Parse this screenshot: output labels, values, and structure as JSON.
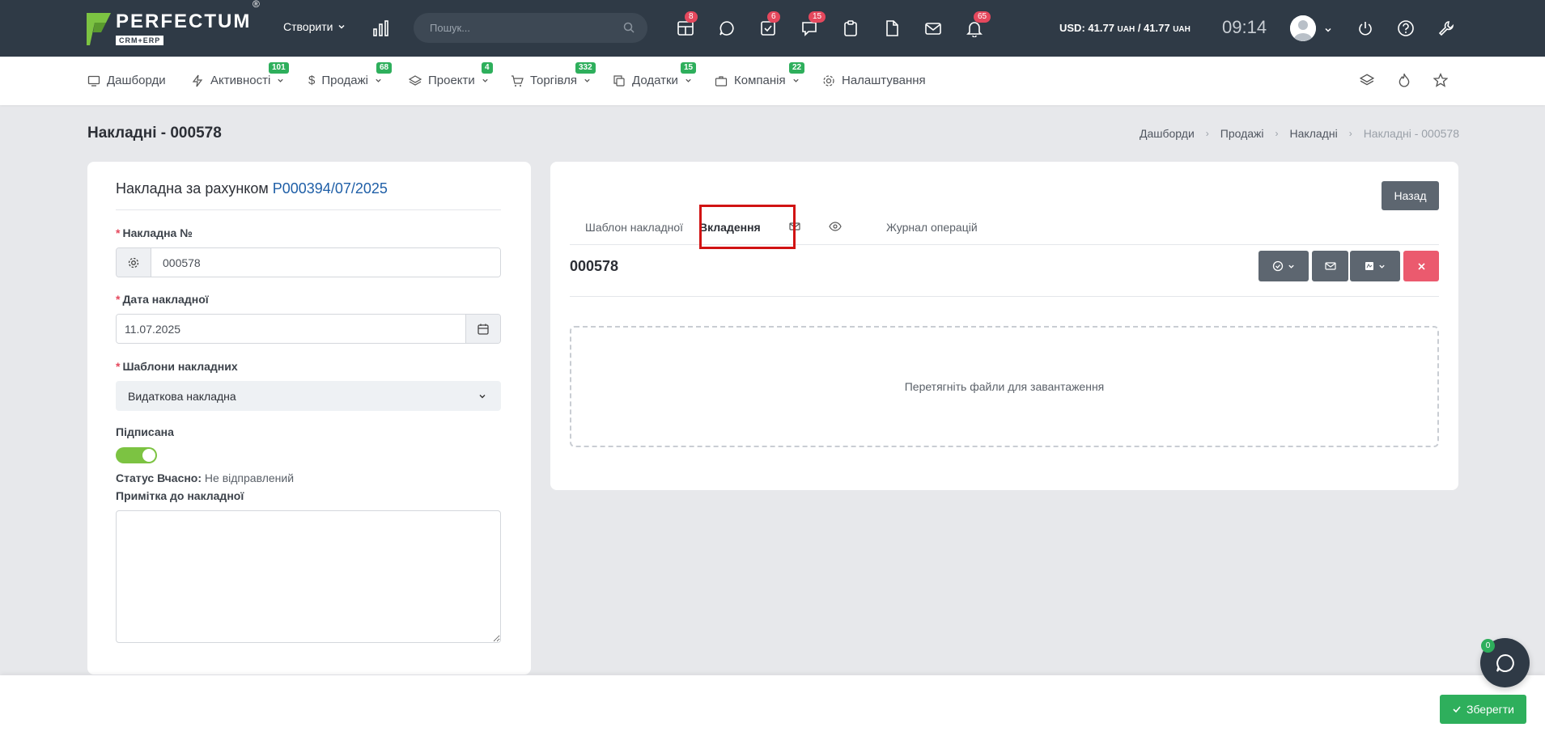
{
  "topbar": {
    "logo_name": "PERFECTUM",
    "logo_sub": "CRM+ERP",
    "logo_reg": "®",
    "create_label": "Створити",
    "search_placeholder": "Пошук...",
    "icons": [
      {
        "name": "table-icon",
        "badge": "8"
      },
      {
        "name": "chat-icon",
        "badge": ""
      },
      {
        "name": "tasks-icon",
        "badge": "6"
      },
      {
        "name": "comments-icon",
        "badge": "15"
      },
      {
        "name": "clipboard-icon",
        "badge": ""
      },
      {
        "name": "document-icon",
        "badge": ""
      },
      {
        "name": "mail-icon",
        "badge": ""
      },
      {
        "name": "bell-icon",
        "badge": "65"
      }
    ],
    "currency_prefix": "USD: 41.77 ",
    "currency_unit1": "UAH",
    "currency_mid": " / 41.77 ",
    "currency_unit2": "UAH",
    "time": "09:14"
  },
  "menu": {
    "items": [
      {
        "label": "Дашборди",
        "badge": ""
      },
      {
        "label": "Активності",
        "badge": "101"
      },
      {
        "label": "Продажі",
        "badge": "68"
      },
      {
        "label": "Проекти",
        "badge": "4"
      },
      {
        "label": "Торгівля",
        "badge": "332"
      },
      {
        "label": "Додатки",
        "badge": "15"
      },
      {
        "label": "Компанія",
        "badge": "22"
      },
      {
        "label": "Налаштування",
        "badge": ""
      }
    ]
  },
  "page": {
    "title": "Накладні - 000578",
    "breadcrumb": [
      "Дашборди",
      "Продажі",
      "Накладні",
      "Накладні - 000578"
    ]
  },
  "form": {
    "title_prefix": "Накладна за рахунком ",
    "title_link": "P000394/07/2025",
    "number_label": "Накладна №",
    "number_value": "000578",
    "date_label": "Дата накладної",
    "date_value": "11.07.2025",
    "template_label": "Шаблони накладних",
    "template_value": "Видаткова накладна",
    "signed_label": "Підписана",
    "signed": true,
    "status_label": "Статус Вчасно:",
    "status_value": " Не відправлений",
    "note_label": "Примітка до накладної",
    "note_value": "",
    "required_mark": "*"
  },
  "details": {
    "back_label": "Назад",
    "tabs": [
      {
        "label": "Шаблон накладної",
        "active": false
      },
      {
        "label": "Вкладення",
        "active": true
      },
      {
        "label": "",
        "icon": "mail-icon"
      },
      {
        "label": "",
        "icon": "eye-icon"
      },
      {
        "label": "Журнал операцій",
        "active": false
      }
    ],
    "doc_number": "000578",
    "dropzone_text": "Перетягніть файли для завантаження"
  },
  "footer": {
    "save_label": "Зберегти",
    "chat_badge": "0"
  },
  "colors": {
    "topbar": "#2f3a46",
    "accent_green": "#2eaf5c",
    "badge_red": "#e5485d",
    "link_blue": "#1f5fa7",
    "highlight_red": "#d11313"
  }
}
